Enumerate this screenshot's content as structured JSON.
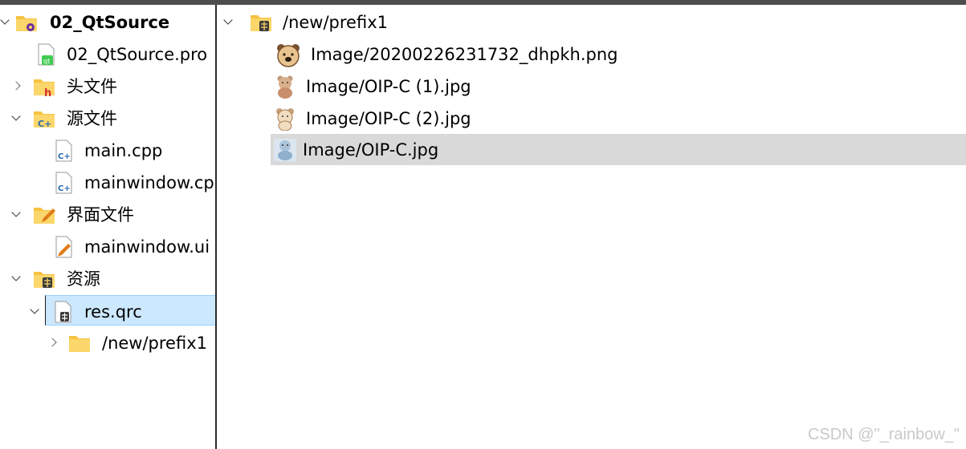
{
  "left_tree": {
    "project": {
      "label": "02_QtSource"
    },
    "pro_file": {
      "label": "02_QtSource.pro"
    },
    "headers": {
      "label": "头文件"
    },
    "sources": {
      "label": "源文件",
      "children": [
        {
          "label": "main.cpp"
        },
        {
          "label": "mainwindow.cpp"
        }
      ]
    },
    "forms": {
      "label": "界面文件",
      "children": [
        {
          "label": "mainwindow.ui"
        }
      ]
    },
    "resources": {
      "label": "资源",
      "qrc": {
        "label": "res.qrc"
      },
      "prefix": {
        "label": "/new/prefix1"
      }
    }
  },
  "right_tree": {
    "prefix": {
      "label": "/new/prefix1"
    },
    "files": [
      {
        "label": "Image/20200226231732_dhpkh.png"
      },
      {
        "label": "Image/OIP-C (1).jpg"
      },
      {
        "label": "Image/OIP-C (2).jpg"
      },
      {
        "label": "Image/OIP-C.jpg"
      }
    ],
    "selected_index": 3
  },
  "watermark": "CSDN @\"_rainbow_\"",
  "colors": {
    "selection_left": "#cce8ff",
    "selection_right": "#d9d9d9",
    "folder": "#f5c342",
    "qt_green": "#41cd52",
    "cpp_blue": "#2b6cb0"
  }
}
